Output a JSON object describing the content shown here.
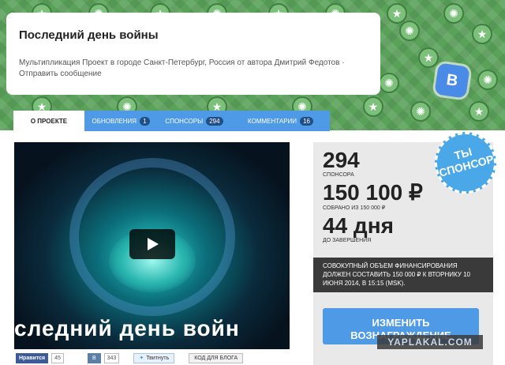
{
  "header": {
    "title": "Последний день войны",
    "description": "Мультипликация Проект в городе Санкт-Петербург, Россия от автора Дмитрий Федотов · Отправить сообщение"
  },
  "vk_badge": {
    "label": "В",
    "icon": "vk-icon"
  },
  "tabs": [
    {
      "label": "О ПРОЕКТЕ",
      "count": ""
    },
    {
      "label": "ОБНОВЛЕНИЯ",
      "count": "1"
    },
    {
      "label": "СПОНСОРЫ",
      "count": "294"
    },
    {
      "label": "КОММЕНТАРИИ",
      "count": "16"
    }
  ],
  "video": {
    "caption": "следний день войн",
    "play_icon": "play-icon"
  },
  "share": {
    "fb_label": "Нравится",
    "fb_count": "45",
    "vk_label": "В",
    "vk_count": "343",
    "twitter_label": "Твитнуть",
    "embed_label": "КОД ДЛЯ БЛОГА"
  },
  "stats": {
    "sponsors_count": "294",
    "sponsors_label": "СПОНСОРА",
    "raised": "150 100 ₽",
    "raised_label": "СОБРАНО ИЗ 150 000 ₽",
    "days_left": "44 дня",
    "days_label": "ДО ЗАВЕРШЕНИЯ",
    "funding_note": "Совокупный объем финансирования должен составить 150 000 ₽ к вторнику 10 июня 2014, в 15:15 (MSK).",
    "change_reward": "ИЗМЕНИТЬ ВОЗНАГРАЖДЕНИЕ"
  },
  "sponsor_badge": {
    "line1": "ТЫ",
    "line2": "СПОНСОР"
  },
  "watermark": "YAPLAKAL.COM",
  "colors": {
    "accent": "#4e9ae6",
    "header_green": "#5aa25a",
    "dark": "#3a3a3a"
  }
}
